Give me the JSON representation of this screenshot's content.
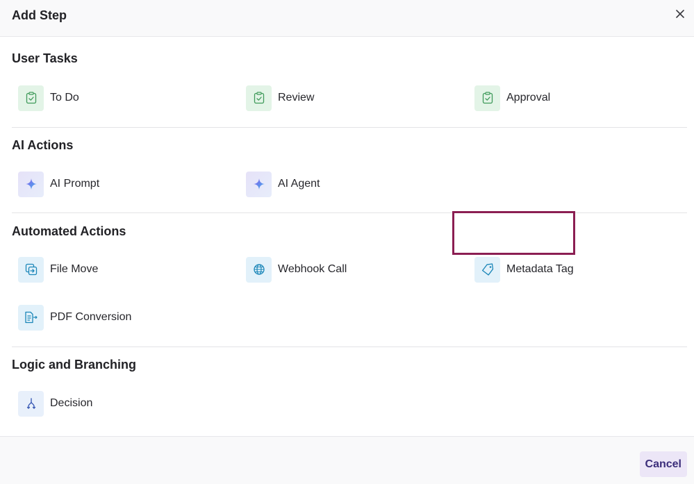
{
  "dialog": {
    "title": "Add Step",
    "close_label": "×",
    "cancel_label": "Cancel"
  },
  "sections": [
    {
      "title": "User Tasks",
      "items": [
        {
          "label": "To Do",
          "icon": "clipboard-check-icon"
        },
        {
          "label": "Review",
          "icon": "clipboard-check-icon"
        },
        {
          "label": "Approval",
          "icon": "clipboard-check-icon"
        }
      ]
    },
    {
      "title": "AI Actions",
      "items": [
        {
          "label": "AI Prompt",
          "icon": "sparkle-icon"
        },
        {
          "label": "AI Agent",
          "icon": "sparkle-icon"
        }
      ]
    },
    {
      "title": "Automated Actions",
      "items": [
        {
          "label": "File Move",
          "icon": "file-move-icon"
        },
        {
          "label": "Webhook Call",
          "icon": "globe-icon"
        },
        {
          "label": "Metadata Tag",
          "icon": "tag-icon"
        },
        {
          "label": "PDF Conversion",
          "icon": "pdf-conversion-icon"
        }
      ]
    },
    {
      "title": "Logic and Branching",
      "items": [
        {
          "label": "Decision",
          "icon": "branch-icon"
        }
      ]
    }
  ],
  "colors": {
    "task_icon_bg": "#e3f4e7",
    "task_icon_fg": "#3f9a5a",
    "ai_icon_fg": "#6b5ce7",
    "automation_icon_bg": "#e2f1fa",
    "automation_icon_fg": "#1b86b8",
    "logic_icon_fg": "#3b5bb5",
    "highlight_border": "#8b1e52",
    "cancel_bg": "#ece6f7",
    "cancel_fg": "#3b2d7a"
  }
}
